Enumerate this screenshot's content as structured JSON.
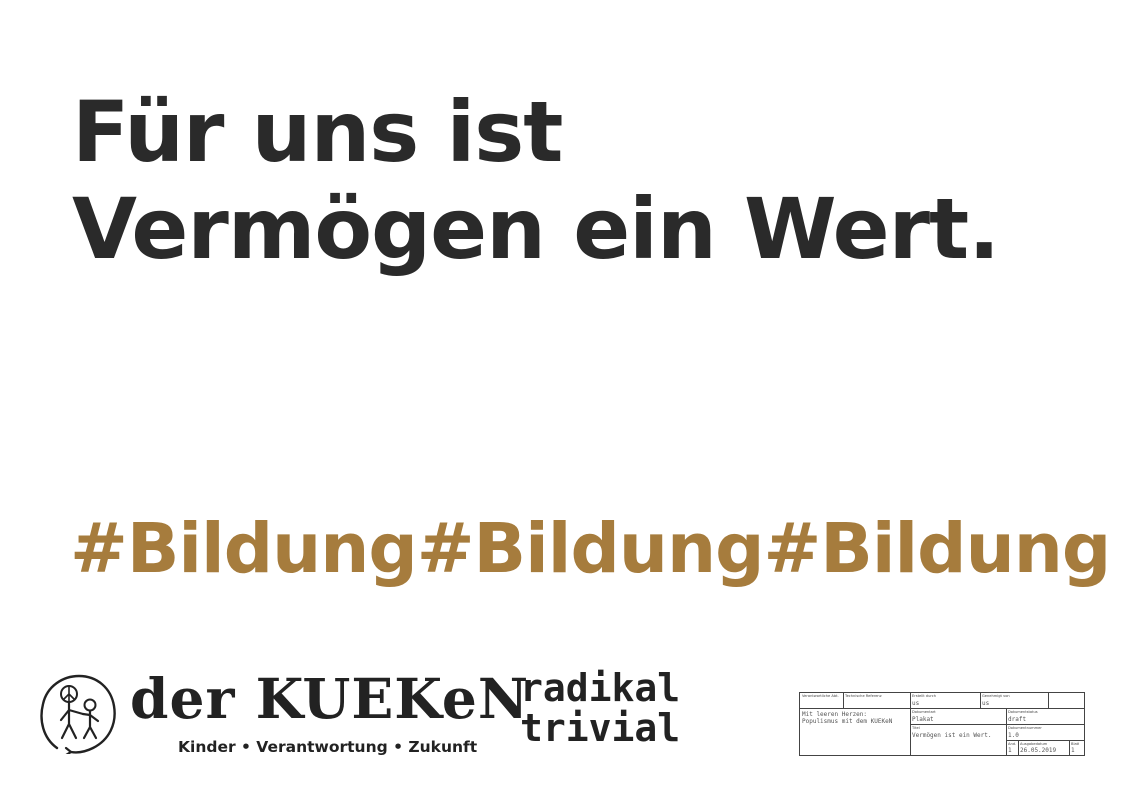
{
  "headline": {
    "line1": "Für uns ist",
    "line2": "Vermögen ein Wert."
  },
  "hashtags": {
    "text": "#Bildung#Bildung#Bildung",
    "color": "#a67c3d"
  },
  "logo": {
    "icon": "peace-sign-stick-figures-icon",
    "brand": "der KUEKeN",
    "tagline": "Kinder • Verantwortung • Zukunft",
    "motto_line1": "radikal",
    "motto_line2": "trivial"
  },
  "title_block": {
    "label_responsible_dept": "Verantwortliche Abt.",
    "label_technical_ref": "Technische Referenz",
    "label_created_by": "Erstellt durch",
    "created_by": "us",
    "label_approved_by": "Genehmigt von",
    "approved_by": "us",
    "label_doc_type": "Dokumentart",
    "doc_type": "Plakat",
    "label_doc_status": "Dokumentstatus",
    "doc_status": "draft",
    "project_line1": "Mit leeren Herzen:",
    "project_line2": "Populismus mit dem KUEKeN",
    "label_title": "Titel",
    "title": "Vermögen ist ein Wert.",
    "label_doc_number": "Dokumentnummer",
    "doc_number": "1.0",
    "label_revision": "Änd.",
    "revision": "1",
    "label_issue_date": "Ausgabedatum",
    "issue_date": "26.05.2019",
    "label_sheet": "Blatt",
    "sheet": "1"
  }
}
